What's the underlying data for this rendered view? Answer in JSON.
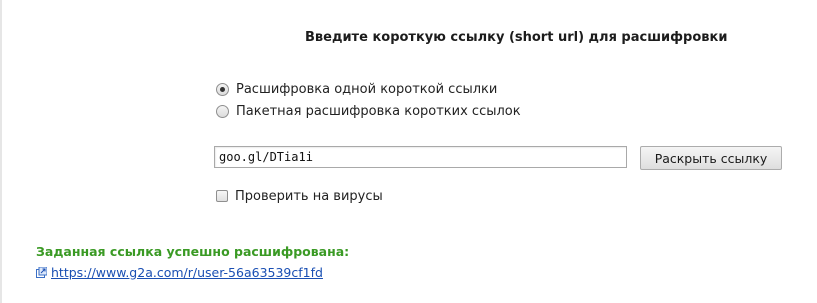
{
  "form": {
    "heading": "Введите короткую ссылку (short url) для расшифровки",
    "mode_options": [
      {
        "label": "Расшифровка одной короткой ссылки",
        "selected": true
      },
      {
        "label": "Пакетная расшифровка коротких ссылок",
        "selected": false
      }
    ],
    "url_input": {
      "value": "goo.gl/DTia1i"
    },
    "submit_label": "Раскрыть ссылку",
    "virus_check": {
      "label": "Проверить на вирусы",
      "checked": false
    }
  },
  "result": {
    "status_text": "Заданная ссылка успешно расшифрована:",
    "status_color": "#3a9a24",
    "link_text": "https://www.g2a.com/r/user-56a63539cf1fd",
    "link_color": "#1a4fb3",
    "link_icon": "external-link-icon"
  }
}
